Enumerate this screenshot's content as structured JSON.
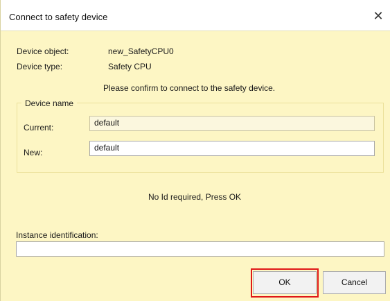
{
  "window": {
    "title": "Connect to safety device",
    "close_glyph": "✕"
  },
  "info": {
    "device_object_label": "Device object:",
    "device_object_value": "new_SafetyCPU0",
    "device_type_label": "Device type:",
    "device_type_value": "Safety CPU",
    "confirm_message": "Please confirm to connect to the safety device."
  },
  "device_name_group": {
    "legend": "Device name",
    "current_label": "Current:",
    "current_value": "default",
    "new_label": "New:",
    "new_value": "default"
  },
  "status_message": "No Id required, Press OK",
  "instance": {
    "label": "Instance identification:",
    "value": ""
  },
  "buttons": {
    "ok_label": "OK",
    "cancel_label": "Cancel"
  }
}
